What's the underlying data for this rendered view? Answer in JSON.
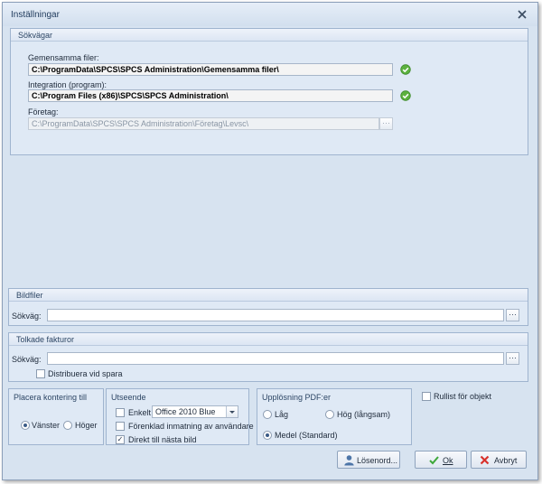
{
  "window": {
    "title": "Inställningar"
  },
  "sokvagar": {
    "header": "Sökvägar",
    "gemensamma_label": "Gemensamma filer:",
    "gemensamma_value": "C:\\ProgramData\\SPCS\\SPCS Administration\\Gemensamma filer\\",
    "integration_label": "Integration (program):",
    "integration_value": "C:\\Program Files (x86)\\SPCS\\SPCS Administration\\",
    "foretag_label": "Företag:",
    "foretag_value": "C:\\ProgramData\\SPCS\\SPCS Administration\\Företag\\Levsc\\",
    "ellipsis": "···"
  },
  "bildfiler": {
    "header": "Bildfiler",
    "path_label": "Sökväg:",
    "path_value": "",
    "ellipsis": "···"
  },
  "tolkade": {
    "header": "Tolkade fakturor",
    "path_label": "Sökväg:",
    "path_value": "",
    "ellipsis": "···",
    "distribuera_label": "Distribuera vid spara",
    "distribuera_checked": false
  },
  "placera": {
    "header": "Placera kontering till",
    "vanster": "Vänster",
    "hoger": "Höger",
    "selected": "vanster"
  },
  "utseende": {
    "header": "Utseende",
    "enkelt_label": "Enkelt",
    "enkelt_checked": false,
    "theme_value": "Office 2010 Blue",
    "forenklad_label": "Förenklad inmatning av användare",
    "forenklad_checked": false,
    "direkt_label": "Direkt till nästa bild",
    "direkt_checked": true
  },
  "upplosning": {
    "header": "Upplösning PDF:er",
    "lag": "Låg",
    "hog": "Hög (långsam)",
    "medel": "Medel (Standard)",
    "selected": "medel"
  },
  "rullist": {
    "label": "Rullist för objekt",
    "checked": false
  },
  "buttons": {
    "losenord": "Lösenord...",
    "ok": "Ok",
    "avbryt": "Avbryt"
  },
  "colors": {
    "ok_green": "#3ea83a",
    "cancel_red": "#d8322c",
    "window_bg": "#d7e3f0"
  }
}
